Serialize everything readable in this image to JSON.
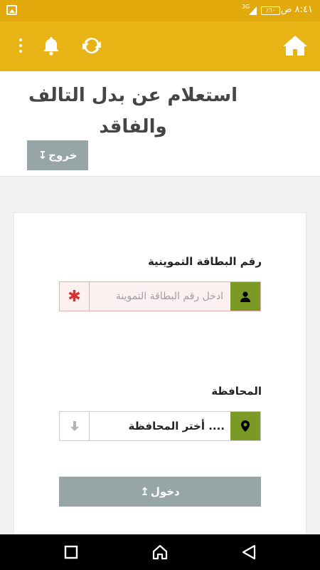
{
  "status_bar": {
    "time": "٨:٤١ ص",
    "battery": "٪٦٠",
    "network": "3G",
    "notification_icon": "image-icon"
  },
  "toolbar": {
    "icons": [
      "more-vertical-icon",
      "bell-icon",
      "sync-icon",
      "home-icon"
    ],
    "background": "#e7b315"
  },
  "page": {
    "title_line1": "استعلام عن بدل التالف",
    "title_line2": "والفاقد",
    "logout_label": "خروج"
  },
  "form": {
    "card_number_label": "رقم البطاقة التموينية",
    "card_number_placeholder": "ادخل رقم البطاقة التموينة",
    "card_number_value": "",
    "required_mark": "✱",
    "governorate_label": "المحافظة",
    "governorate_selected": ".... أختر المحافظة",
    "login_label": "دخول"
  },
  "colors": {
    "accent_green": "#7b9a25",
    "button_gray": "#97a5a6",
    "required_red": "#d9302c",
    "status_bar": "#e2a90c"
  }
}
